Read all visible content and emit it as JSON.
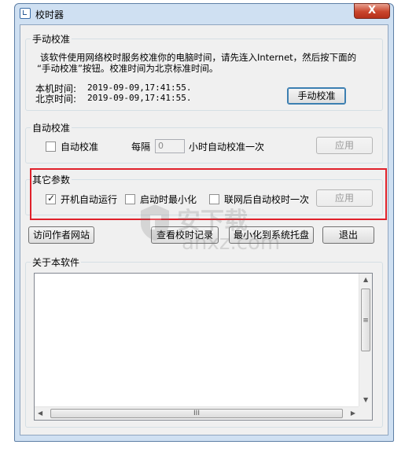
{
  "window": {
    "title": "校时器",
    "close_label": "X"
  },
  "manual": {
    "legend": "手动校准",
    "desc_line1": "该软件使用网络校时服务校准你的电脑时间，请先连入Internet，然后按下面的",
    "desc_line2": "“手动校准”按钮。校准时间为北京标准时间。",
    "local_time_label": "本机时间:",
    "local_time_value": "2019-09-09,17:41:55.",
    "beijing_time_label": "北京时间:",
    "beijing_time_value": "2019-09-09,17:41:55.",
    "calibrate_button": "手动校准"
  },
  "auto": {
    "legend": "自动校准",
    "checkbox_label": "自动校准",
    "checked": false,
    "interval_prefix": "每隔",
    "interval_value": "0",
    "interval_suffix": "小时自动校准一次",
    "apply_button": "应用"
  },
  "other": {
    "legend": "其它参数",
    "options": [
      {
        "label": "开机自动运行",
        "checked": true
      },
      {
        "label": "启动时最小化",
        "checked": false
      },
      {
        "label": "联网后自动校时一次",
        "checked": false
      }
    ],
    "apply_button": "应用"
  },
  "actions": {
    "visit_site": "访问作者网站",
    "view_log": "查看校时记录",
    "minimize_tray": "最小化到系统托盘",
    "exit": "退出"
  },
  "about": {
    "legend": "关于本软件"
  },
  "watermark": {
    "brand": "安下载",
    "domain": "anxz.com"
  },
  "colors": {
    "highlight": "#e0212b",
    "window_frame": "#cfe0f2",
    "close_button": "#c9452c"
  },
  "icons": {
    "app": "clock-app-icon",
    "close": "close-icon"
  }
}
